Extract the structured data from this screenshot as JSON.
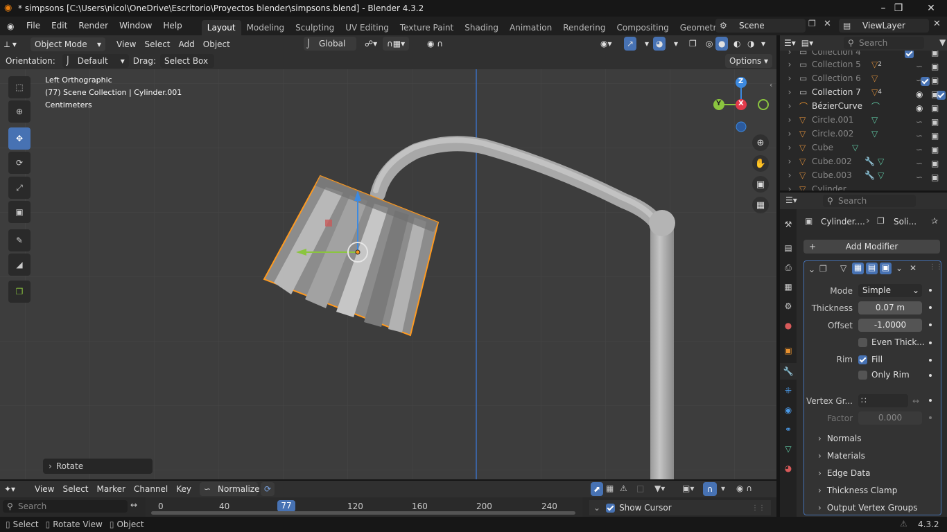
{
  "window": {
    "title": "* simpsons [C:\\Users\\nicol\\OneDrive\\Escritorio\\Proyectos blender\\simpsons.blend] - Blender 4.3.2",
    "minimize": "–",
    "maximize": "❒",
    "close": "✕"
  },
  "menubar": {
    "items": [
      "File",
      "Edit",
      "Render",
      "Window",
      "Help"
    ],
    "workspaces": [
      "Layout",
      "Modeling",
      "Sculpting",
      "UV Editing",
      "Texture Paint",
      "Shading",
      "Animation",
      "Rendering",
      "Compositing",
      "Geometry Node"
    ],
    "active_workspace": "Layout",
    "scene": "Scene",
    "view_layer": "ViewLayer"
  },
  "viewport_header": {
    "mode": "Object Mode",
    "menus": [
      "View",
      "Select",
      "Add",
      "Object"
    ],
    "transform_orientation": "Global",
    "orientation_label": "Orientation:",
    "orientation_value": "Default",
    "drag_label": "Drag:",
    "drag_value": "Select Box",
    "options": "Options"
  },
  "viewport": {
    "view_name": "Left Orthographic",
    "collection_info": "(77) Scene Collection | Cylinder.001",
    "units": "Centimeters",
    "last_op": "Rotate",
    "gizmo_z": "Z",
    "gizmo_y": "Y",
    "gizmo_x": "X"
  },
  "outliner": {
    "search_placeholder": "Search",
    "rows": [
      {
        "name": "Collection 4",
        "type": "collection",
        "badge": ""
      },
      {
        "name": "Collection 5",
        "type": "collection",
        "badge": "2"
      },
      {
        "name": "Collection 6",
        "type": "collection",
        "badge": ""
      },
      {
        "name": "Collection 7",
        "type": "collection",
        "badge": "4"
      },
      {
        "name": "BézierCurve",
        "type": "curve",
        "badge": ""
      },
      {
        "name": "Circle.001",
        "type": "mesh",
        "badge": ""
      },
      {
        "name": "Circle.002",
        "type": "mesh",
        "badge": ""
      },
      {
        "name": "Cube",
        "type": "mesh",
        "badge": ""
      },
      {
        "name": "Cube.002",
        "type": "mesh",
        "badge": ""
      },
      {
        "name": "Cube.003",
        "type": "mesh",
        "badge": ""
      },
      {
        "name": "Cylinder",
        "type": "mesh",
        "badge": ""
      }
    ]
  },
  "properties": {
    "search_placeholder": "Search",
    "breadcrumb_object": "Cylinder....",
    "breadcrumb_modifier": "Soli...",
    "add_modifier": "Add Modifier",
    "mode_label": "Mode",
    "mode_value": "Simple",
    "thickness_label": "Thickness",
    "thickness_value": "0.07 m",
    "offset_label": "Offset",
    "offset_value": "-1.0000",
    "even_thickness": "Even Thick...",
    "rim_label": "Rim",
    "fill_label": "Fill",
    "only_rim": "Only Rim",
    "vertex_group_label": "Vertex Gr...",
    "factor_label": "Factor",
    "factor_value": "0.000",
    "panels": [
      "Normals",
      "Materials",
      "Edge Data",
      "Thickness Clamp",
      "Output Vertex Groups"
    ]
  },
  "timeline": {
    "menus": [
      "View",
      "Select",
      "Marker",
      "Channel",
      "Key"
    ],
    "normalize": "Normalize",
    "search_placeholder": "Search",
    "current_frame": "77",
    "ticks": [
      "0",
      "40",
      "120",
      "160",
      "200",
      "240"
    ],
    "show_cursor": "Show Cursor"
  },
  "statusbar": {
    "select": "Select",
    "rotate_view": "Rotate View",
    "object": "Object",
    "version": "4.3.2"
  },
  "colors": {
    "accent": "#4772b3",
    "selection_outline": "#ff9a1f",
    "axis_x": "#e23a4a",
    "axis_y": "#8bc53f",
    "axis_z": "#3d8ae0"
  }
}
